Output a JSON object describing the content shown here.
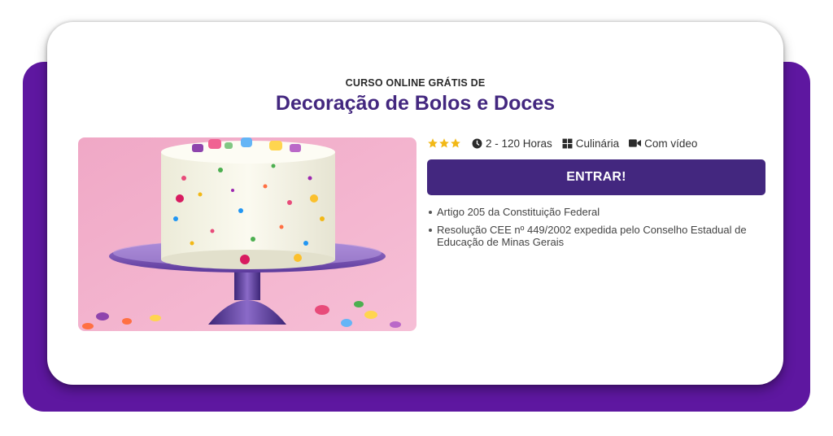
{
  "course": {
    "eyebrow": "CURSO ONLINE GRÁTIS DE",
    "title": "Decoração de Bolos e Doces",
    "rating_stars": 3,
    "duration": "2 - 120 Horas",
    "category": "Culinária",
    "media": "Com vídeo",
    "cta_label": "ENTRAR!",
    "image_alt": "Bolo decorado com confeitos coloridos"
  },
  "icons": {
    "rating": "star-icon",
    "duration": "clock-icon",
    "category": "grid-icon",
    "media": "video-camera-icon"
  },
  "legal": [
    "Artigo 205 da Constituição Federal",
    "Resolução CEE nº 449/2002 expedida pelo Conselho Estadual de Educação de Minas Gerais"
  ],
  "colors": {
    "brand_purple": "#43277f",
    "background_purple": "#5e17a0",
    "star_gold": "#f2b816"
  }
}
